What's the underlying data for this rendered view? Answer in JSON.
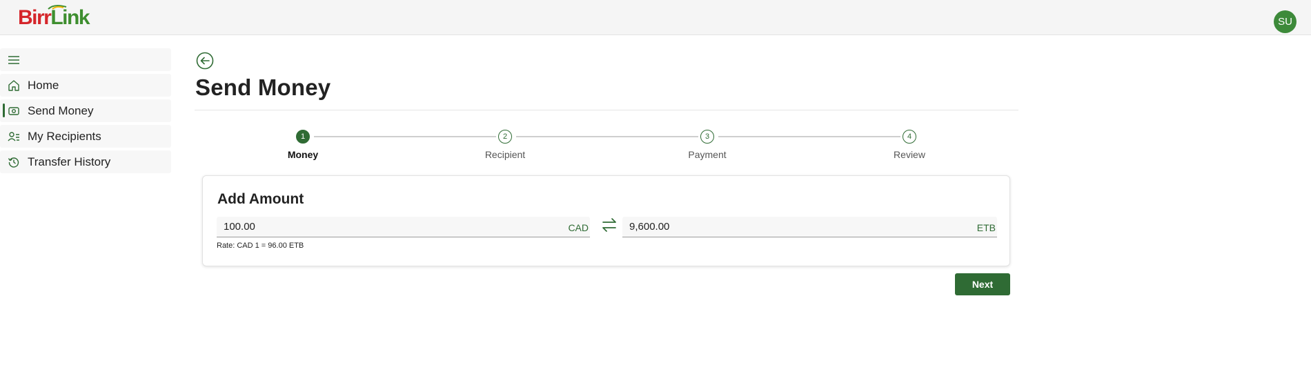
{
  "app": {
    "logo_part1": "Birr",
    "logo_part2": "Link",
    "avatar_initials": "SU",
    "brand_color": "#2f6b34"
  },
  "sidebar": {
    "items": [
      {
        "label": "Home",
        "icon": "home-icon"
      },
      {
        "label": "Send Money",
        "icon": "money-icon",
        "active": true
      },
      {
        "label": "My Recipients",
        "icon": "recipients-icon"
      },
      {
        "label": "Transfer History",
        "icon": "history-icon"
      }
    ]
  },
  "main": {
    "title": "Send Money",
    "steps": [
      {
        "number": "1",
        "label": "Money",
        "state": "current"
      },
      {
        "number": "2",
        "label": "Recipient",
        "state": "todo"
      },
      {
        "number": "3",
        "label": "Payment",
        "state": "todo"
      },
      {
        "number": "4",
        "label": "Review",
        "state": "todo"
      }
    ],
    "card": {
      "title": "Add Amount",
      "send_amount": "100.00",
      "send_currency": "CAD",
      "receive_amount": "9,600.00",
      "receive_currency": "ETB",
      "rate_text": "Rate: CAD 1 = 96.00 ETB"
    },
    "next_label": "Next"
  }
}
